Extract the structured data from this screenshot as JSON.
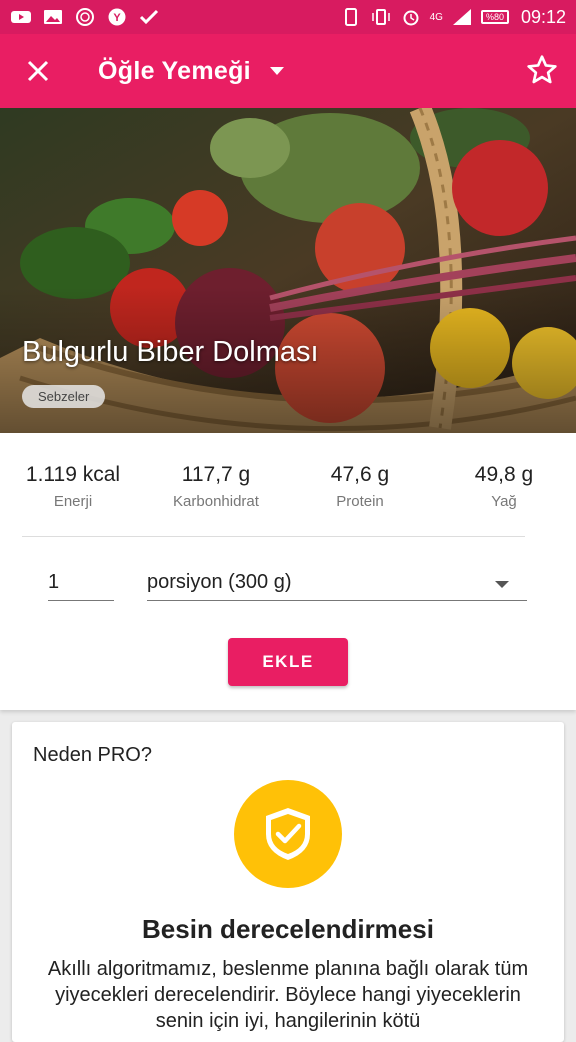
{
  "status_bar": {
    "time": "09:12",
    "network": "4G",
    "battery": "%80",
    "left_icons": [
      "youtube-icon",
      "gallery-icon",
      "browser-icon",
      "yandex-icon",
      "check-app-icon"
    ],
    "right_icons": [
      "phone-icon",
      "vibrate-icon",
      "alarm-icon",
      "signal-icon",
      "battery-icon"
    ]
  },
  "toolbar": {
    "title": "Öğle Yemeği",
    "close_icon": "close-icon",
    "dropdown_icon": "chevron-down-icon",
    "star_icon": "star-outline-icon"
  },
  "hero": {
    "title": "Bulgurlu Biber Dolması",
    "tag": "Sebzeler"
  },
  "nutrition": [
    {
      "value": "1.119 kcal",
      "label": "Enerji"
    },
    {
      "value": "117,7 g",
      "label": "Karbonhidrat"
    },
    {
      "value": "47,6 g",
      "label": "Protein"
    },
    {
      "value": "49,8 g",
      "label": "Yağ"
    }
  ],
  "serving": {
    "quantity": "1",
    "unit": "porsiyon (300 g)"
  },
  "add_button": "EKLE",
  "pro": {
    "heading": "Neden PRO?",
    "badge_icon": "shield-check-icon",
    "title": "Besin derecelendirmesi",
    "text": "Akıllı algoritmamız, beslenme planına bağlı olarak tüm yiyecekleri derecelendirir. Böylece hangi yiyeceklerin senin için iyi, hangilerinin kötü"
  },
  "colors": {
    "primary": "#e91e63",
    "primary_dark": "#d81b60",
    "badge": "#ffc107"
  }
}
